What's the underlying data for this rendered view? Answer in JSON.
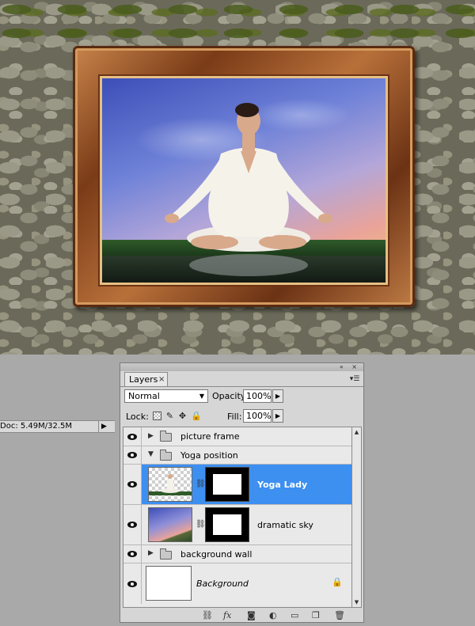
{
  "status": {
    "doc_size": "Doc: 5.49M/32.5M"
  },
  "layers_panel": {
    "tab_label": "Layers",
    "close_glyph": "×",
    "blend_mode": "Normal",
    "opacity_label": "Opacity:",
    "opacity_value": "100%",
    "lock_label": "Lock:",
    "fill_label": "Fill:",
    "fill_value": "100%",
    "layers": [
      {
        "name": "picture frame",
        "type": "group",
        "expanded": false
      },
      {
        "name": "Yoga position",
        "type": "group",
        "expanded": true
      },
      {
        "name": "Yoga Lady",
        "type": "layer",
        "selected": true,
        "mask": true,
        "icon": "yoga-lady-thumbnail"
      },
      {
        "name": "dramatic sky",
        "type": "layer",
        "selected": false,
        "mask": true,
        "icon": "sky-thumbnail"
      },
      {
        "name": "background wall",
        "type": "group",
        "expanded": false
      },
      {
        "name": "Background",
        "type": "background",
        "locked": true
      }
    ],
    "bottom_icons": [
      "link-icon",
      "fx-icon",
      "add-mask-icon",
      "adjustment-icon",
      "new-group-icon",
      "new-layer-icon",
      "trash-icon"
    ]
  },
  "colors": {
    "selection": "#3d8ff0",
    "panel_bg": "#d6d6d6",
    "workspace": "#a9a9a9"
  }
}
